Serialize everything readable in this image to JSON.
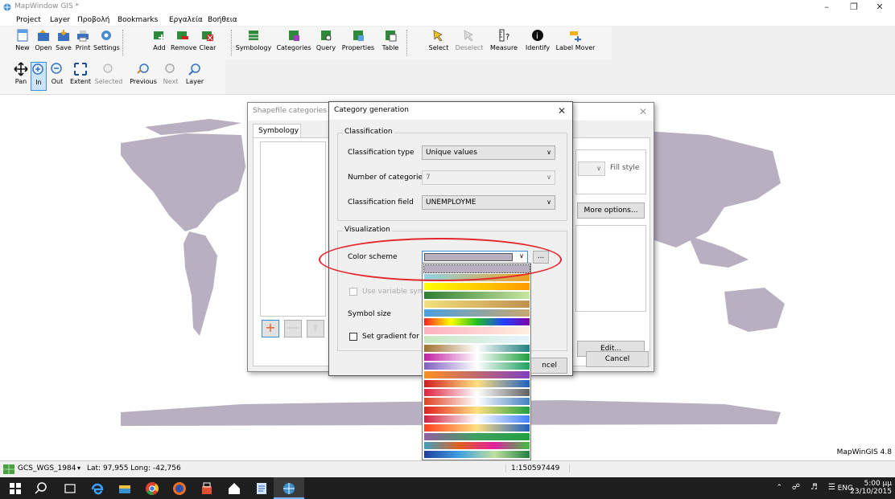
{
  "window": {
    "title": "MapWindow GIS *",
    "minimize_icon": "minimize-icon",
    "maximize_icon": "maximize-icon",
    "close_icon": "close-icon"
  },
  "menu": [
    "Project",
    "Layer",
    "Προβολή",
    "Bookmarks",
    "Εργαλεία",
    "Βοήθεια"
  ],
  "toolbar1": [
    {
      "label": "New",
      "icon": "new-icon"
    },
    {
      "label": "Open",
      "icon": "open-icon"
    },
    {
      "label": "Save",
      "icon": "save-icon"
    },
    {
      "label": "Print",
      "icon": "print-icon"
    },
    {
      "label": "Settings",
      "icon": "settings-icon"
    },
    {
      "label": "Add",
      "icon": "add-layer-icon"
    },
    {
      "label": "Remove",
      "icon": "remove-layer-icon"
    },
    {
      "label": "Clear",
      "icon": "clear-layers-icon"
    },
    {
      "label": "Symbology",
      "icon": "symbology-icon"
    },
    {
      "label": "Categories",
      "icon": "categories-icon"
    },
    {
      "label": "Query",
      "icon": "query-icon"
    },
    {
      "label": "Properties",
      "icon": "properties-icon"
    },
    {
      "label": "Table",
      "icon": "table-icon"
    },
    {
      "label": "Select",
      "icon": "select-icon"
    },
    {
      "label": "Deselect",
      "icon": "deselect-icon"
    },
    {
      "label": "Measure",
      "icon": "measure-icon"
    },
    {
      "label": "Identify",
      "icon": "identify-icon"
    },
    {
      "label": "Label Mover",
      "icon": "label-mover-icon"
    }
  ],
  "toolbar2": [
    {
      "label": "Pan",
      "icon": "pan-icon"
    },
    {
      "label": "In",
      "icon": "zoom-in-icon"
    },
    {
      "label": "Out",
      "icon": "zoom-out-icon"
    },
    {
      "label": "Extent",
      "icon": "zoom-extent-icon"
    },
    {
      "label": "Selected",
      "icon": "zoom-selected-icon"
    },
    {
      "label": "Previous",
      "icon": "zoom-previous-icon"
    },
    {
      "label": "Next",
      "icon": "zoom-next-icon"
    },
    {
      "label": "Layer",
      "icon": "zoom-layer-icon"
    }
  ],
  "map": {
    "version_label": "MapWinGIS 4.8",
    "land_color": "#b8b0c0"
  },
  "status": {
    "projection": "GCS_WGS_1984",
    "coords": "Lat: 97,955 Long: -42,756",
    "scale": "1:150597449"
  },
  "taskbar": {
    "time": "5:00 μμ",
    "date": "23/10/2015",
    "lang": "ENG"
  },
  "shapefile_dialog": {
    "title": "Shapefile categories",
    "tab": "Symbology",
    "fill_style": "Fill style",
    "more_options": "More options...",
    "edit": "Edit...",
    "cancel": "Cancel"
  },
  "category_dialog": {
    "title": "Category generation",
    "classification_group": "Classification",
    "classification_type_label": "Classification type",
    "classification_type_value": "Unique values",
    "num_categories_label": "Number of categories",
    "num_categories_value": "7",
    "classification_field_label": "Classification field",
    "classification_field_value": "UNEMPLOYME",
    "visualization_group": "Visualization",
    "color_scheme_label": "Color scheme",
    "use_variable_label": "Use variable symbol",
    "symbol_size_label": "Symbol size",
    "set_gradient_label": "Set gradient for each",
    "cancel_partial": "ncel",
    "browse_label": "..."
  },
  "color_schemes": [
    [
      "#b8b0c0",
      "#b8b0c0"
    ],
    [
      "#8fd3e6",
      "#f0a020"
    ],
    [
      "#ffff00",
      "#ff9900"
    ],
    [
      "#2e7d32",
      "#c8e6a0"
    ],
    [
      "#f4e07a",
      "#c09050"
    ],
    [
      "#4aa0e0",
      "#c8a870"
    ],
    [
      "#ff2020",
      "#ffff00",
      "#20c020",
      "#2040ff",
      "#8000a0"
    ],
    [
      "#ffb0c0",
      "#fff0e0"
    ],
    [
      "#c8e8c0",
      "#e8f4ff"
    ],
    [
      "#a07030",
      "#ffffff",
      "#208080"
    ],
    [
      "#c020a0",
      "#ffffff",
      "#20a040"
    ],
    [
      "#8060c0",
      "#ffffff",
      "#20a060"
    ],
    [
      "#ff9020",
      "#8040c0"
    ],
    [
      "#d02020",
      "#ffe080",
      "#2060c0"
    ],
    [
      "#e02040",
      "#ffffff",
      "#606060"
    ],
    [
      "#e04020",
      "#ffffff",
      "#4080c0"
    ],
    [
      "#e02020",
      "#ffe080",
      "#20a040"
    ],
    [
      "#d02040",
      "#ffffff",
      "#4080ff"
    ],
    [
      "#ff4020",
      "#ffe080",
      "#2060c0"
    ],
    [
      "#9060a0",
      "#40a060",
      "#20a040"
    ],
    [
      "#40a0c0",
      "#e06020",
      "#e020a0",
      "#40c040"
    ],
    [
      "#2040a0",
      "#40a0e0",
      "#c0e0a0",
      "#208040"
    ]
  ]
}
